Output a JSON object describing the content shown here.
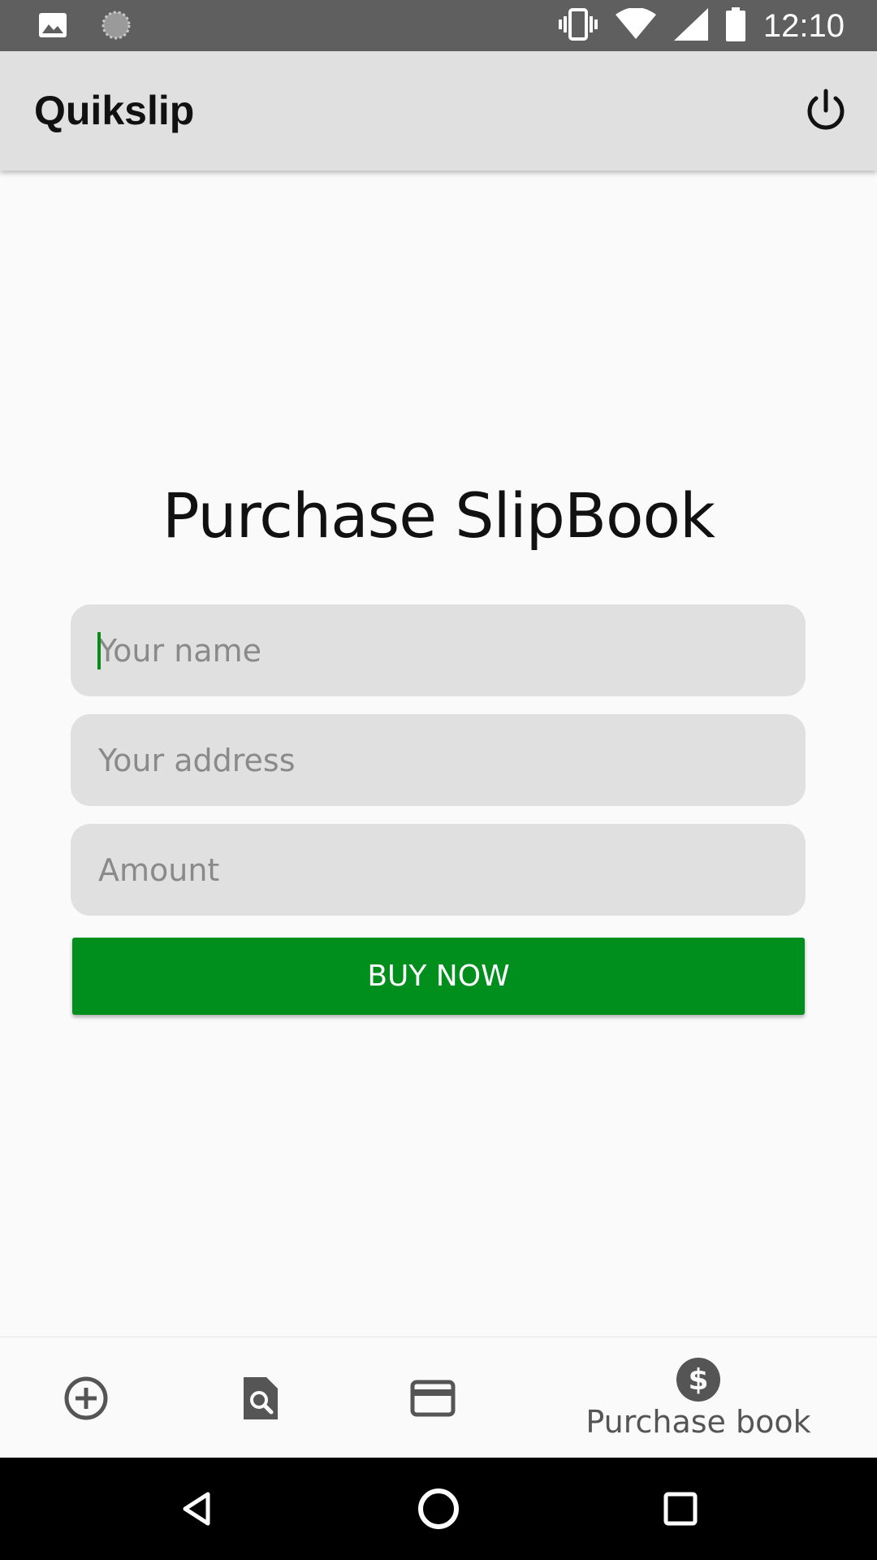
{
  "status_bar": {
    "time": "12:10",
    "icons": [
      "image-icon",
      "loading-icon",
      "vibrate-icon",
      "wifi-icon",
      "signal-icon",
      "battery-icon"
    ]
  },
  "app_bar": {
    "title": "Quikslip",
    "action_icon": "power-icon"
  },
  "main": {
    "title": "Purchase SlipBook",
    "fields": [
      {
        "name": "name",
        "placeholder": "Your name",
        "value": ""
      },
      {
        "name": "address",
        "placeholder": "Your address",
        "value": ""
      },
      {
        "name": "amount",
        "placeholder": "Amount",
        "value": ""
      }
    ],
    "buy_button_label": "BUY NOW"
  },
  "bottom_nav": {
    "items": [
      {
        "icon": "add-circle-icon",
        "label": ""
      },
      {
        "icon": "document-search-icon",
        "label": ""
      },
      {
        "icon": "credit-card-icon",
        "label": ""
      },
      {
        "icon": "dollar-icon",
        "label": "Purchase book",
        "active": true
      }
    ]
  },
  "colors": {
    "accent": "#008f1d",
    "app_bar": "#e0e0e0",
    "status_bar": "#5f5f5f"
  }
}
